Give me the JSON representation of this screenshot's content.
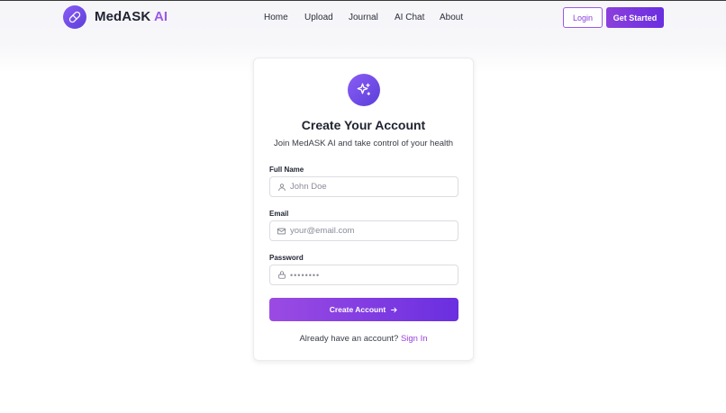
{
  "brand": {
    "name_main": "MedASK",
    "name_ai": "AI",
    "logo_icon": "pill-icon",
    "accent": "#8b3fdc"
  },
  "nav": {
    "items": [
      {
        "label": "Home"
      },
      {
        "label": "Upload"
      },
      {
        "label": "Journal"
      },
      {
        "label": "AI Chat"
      },
      {
        "label": "About"
      }
    ],
    "login_label": "Login",
    "get_started_label": "Get Started"
  },
  "card": {
    "icon": "sparkles-icon",
    "title": "Create Your Account",
    "subtitle": "Join MedASK AI and take control of your health",
    "fields": {
      "full_name": {
        "label": "Full Name",
        "placeholder": "John Doe",
        "icon": "user-icon"
      },
      "email": {
        "label": "Email",
        "placeholder": "your@email.com",
        "icon": "mail-icon"
      },
      "password": {
        "label": "Password",
        "placeholder": "••••••••",
        "icon": "lock-icon"
      }
    },
    "submit_label": "Create Account",
    "submit_icon": "arrow-right-icon",
    "signin_prompt": "Already have an account?",
    "signin_link": "Sign In"
  }
}
